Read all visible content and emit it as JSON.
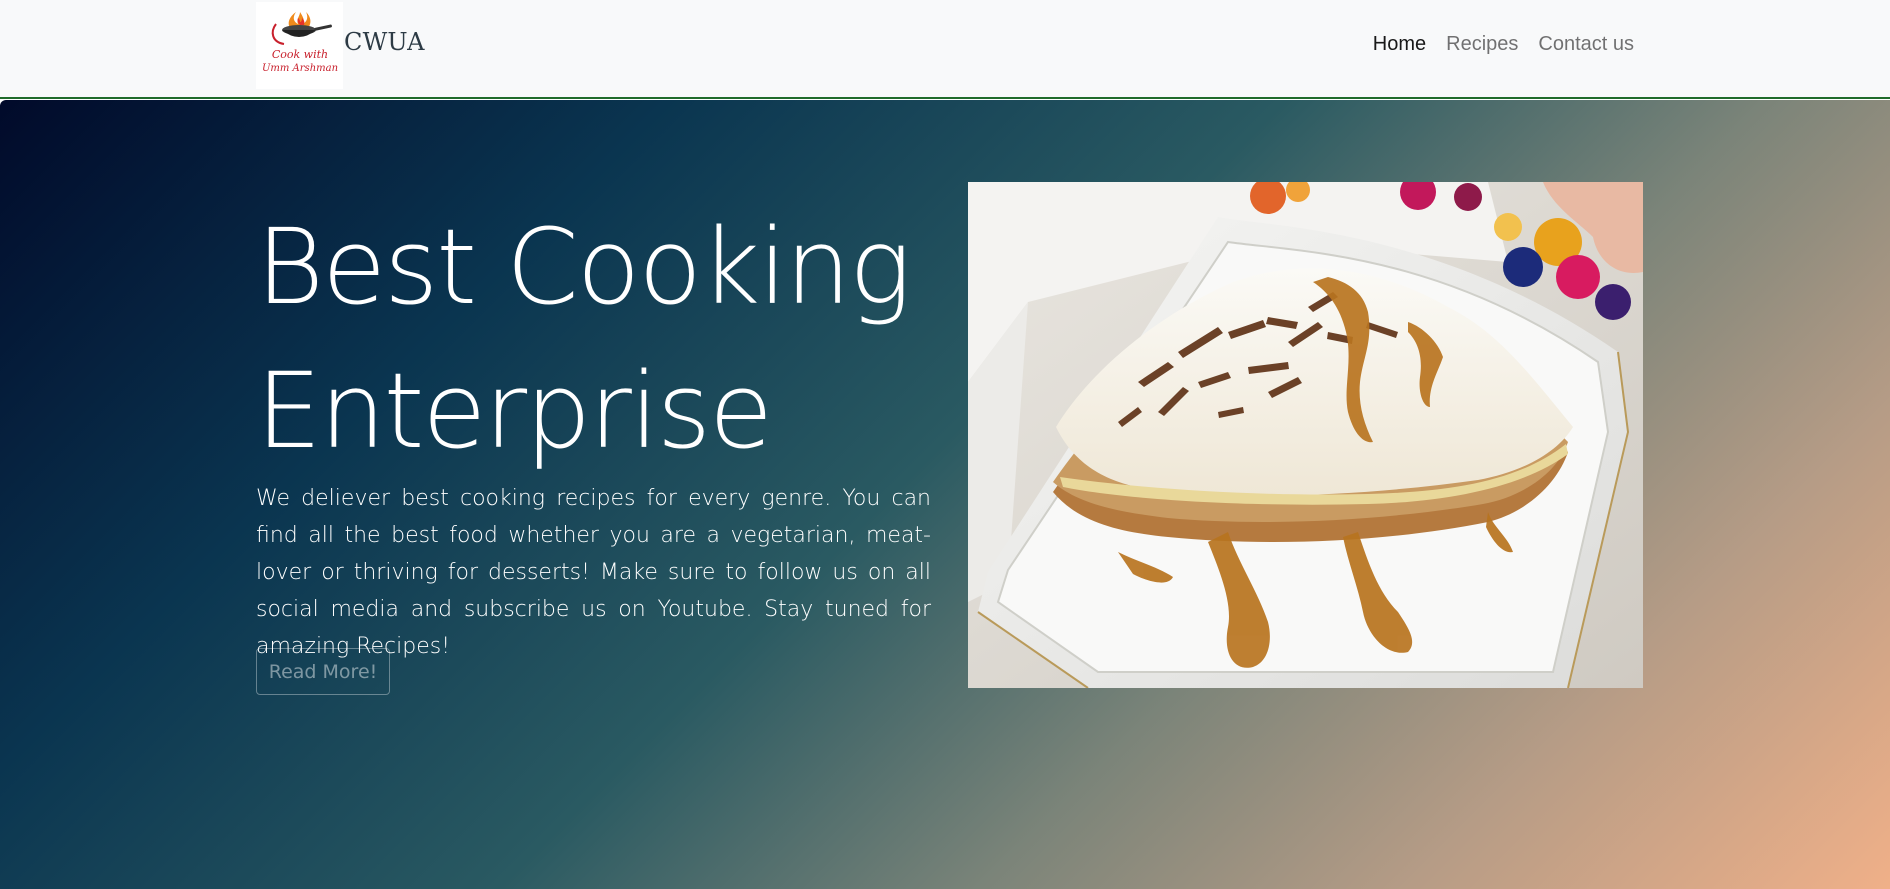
{
  "navbar": {
    "brand": "CWUA",
    "logo_text_line1": "Cook with",
    "logo_text_line2": "Umm Arshman",
    "links": [
      {
        "label": "Home",
        "active": true
      },
      {
        "label": "Recipes",
        "active": false
      },
      {
        "label": "Contact us",
        "active": false
      }
    ]
  },
  "hero": {
    "title": "Best Cooking Enterprise",
    "description": "We deliever best cooking recipes for every genre. You can find all the best food whether you are a vegetarian, meat-lover or thriving for desserts! Make sure to follow us on all social media and subscribe us on Youtube. Stay tuned for amazing Recipes!",
    "button_label": "Read More!",
    "image_icon": "banoffee-pie-photo"
  },
  "colors": {
    "navbar_bg": "#f8f9fa",
    "navbar_border": "#1f6b2a",
    "gradient_start": "#010a2a",
    "gradient_end": "#f0b088",
    "logo_text": "#c8202c"
  }
}
